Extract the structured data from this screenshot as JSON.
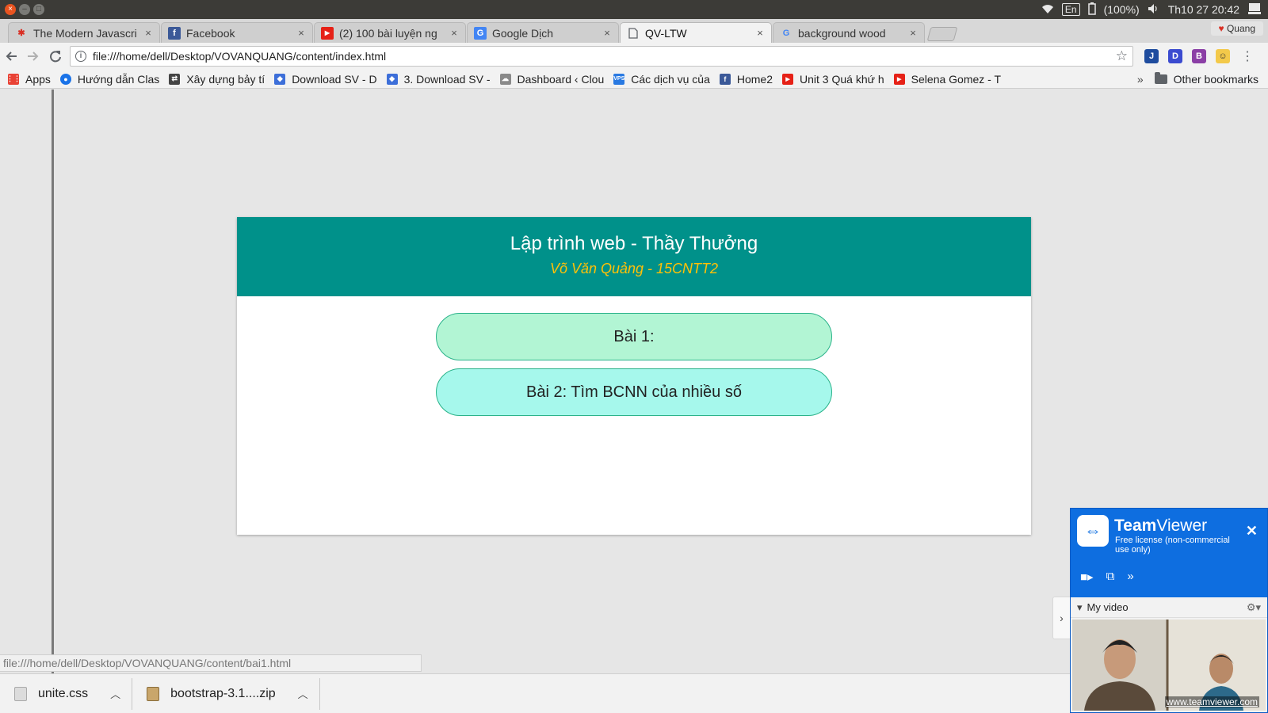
{
  "os_bar": {
    "lang": "En",
    "battery": "(100%)",
    "clock": "Th10 27 20:42"
  },
  "tabs": [
    {
      "title": "The Modern Javascri",
      "close": "×"
    },
    {
      "title": "Facebook",
      "close": "×"
    },
    {
      "title": "(2) 100 bài luyện ng",
      "close": "×"
    },
    {
      "title": "Google Dịch",
      "close": "×"
    },
    {
      "title": "QV-LTW",
      "close": "×"
    },
    {
      "title": "background wood",
      "close": "×"
    }
  ],
  "profile": "Quang",
  "address_bar": {
    "url": "file:///home/dell/Desktop/VOVANQUANG/content/index.html"
  },
  "bookmarks": {
    "items": [
      {
        "label": "Apps",
        "color": "#e94235"
      },
      {
        "label": "Hướng dẫn Clas",
        "color": "#1a73e8"
      },
      {
        "label": "Xây dựng bảy tí",
        "color": "#444444"
      },
      {
        "label": "Download SV - D",
        "color": "#3d6fd9"
      },
      {
        "label": "3. Download SV -",
        "color": "#3d6fd9"
      },
      {
        "label": "Dashboard ‹ Clou",
        "color": "#8a8a8a"
      },
      {
        "label": "Các dịch vụ của",
        "color": "#2a7ae2"
      },
      {
        "label": "Home2",
        "color": "#3b5998"
      },
      {
        "label": "Unit 3 Quá khứ h",
        "color": "#e62117"
      },
      {
        "label": "Selena Gomez - T",
        "color": "#e62117"
      }
    ],
    "more": "»",
    "other": "Other bookmarks"
  },
  "page": {
    "title": "Lập trình web - Thầy Thưởng",
    "subtitle": "Võ Văn Quảng - 15CNTT2",
    "lessons": [
      {
        "label": "Bài 1:"
      },
      {
        "label": "Bài 2: Tìm BCNN của nhiều số"
      }
    ]
  },
  "status_url": "file:///home/dell/Desktop/VOVANQUANG/content/bai1.html",
  "downloads": [
    {
      "name": "unite.css"
    },
    {
      "name": "bootstrap-3.1....zip"
    }
  ],
  "teamviewer": {
    "brand_bold": "Team",
    "brand_rest": "Viewer",
    "license": "Free license (non-commercial use only)",
    "my_video": "My video",
    "link": "www.teamviewer.com"
  },
  "colors": {
    "header_bg": "#00918a",
    "subtitle": "#ffc107",
    "lesson1_bg": "#b2f5d4",
    "lesson2_bg": "#a6f8ec",
    "teamviewer_blue": "#0e6ee0"
  }
}
